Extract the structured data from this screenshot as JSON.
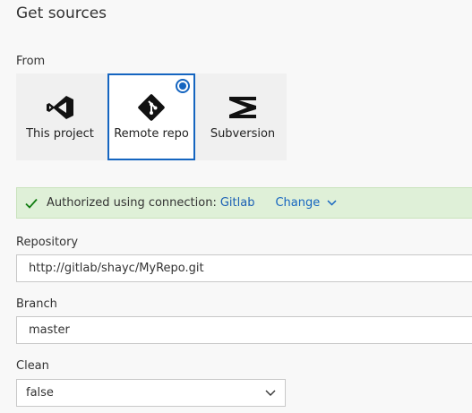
{
  "header": {
    "title": "Get sources"
  },
  "from": {
    "label": "From",
    "sources": [
      {
        "label": "This project",
        "icon": "visual-studio-icon",
        "selected": false
      },
      {
        "label": "Remote repo",
        "icon": "git-icon",
        "selected": true
      },
      {
        "label": "Subversion",
        "icon": "subversion-icon",
        "selected": false
      }
    ]
  },
  "auth": {
    "message": "Authorized using connection:",
    "connection": "Gitlab",
    "change_label": "Change",
    "icon": "check-icon"
  },
  "repository": {
    "label": "Repository",
    "value": "http://gitlab/shayc/MyRepo.git"
  },
  "branch": {
    "label": "Branch",
    "value": "master"
  },
  "clean": {
    "label": "Clean",
    "value": "false"
  },
  "colors": {
    "accent": "#1565c0",
    "success_bg": "#dff0d8",
    "check": "#107c10"
  }
}
